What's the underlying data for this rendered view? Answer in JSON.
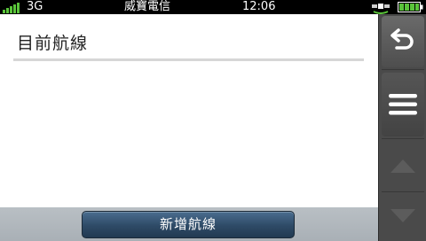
{
  "status_bar": {
    "network": "3G",
    "carrier": "威寶電信",
    "time": "12:06",
    "signal_bars": 5,
    "battery_level": 1.0,
    "accent_color": "#5ac43a"
  },
  "main": {
    "title": "目前航線"
  },
  "bottom_bar": {
    "add_route_label": "新增航線"
  },
  "sidebar": {
    "icons": [
      "back-arrow-icon",
      "menu-icon",
      "arrow-up-icon",
      "arrow-down-icon"
    ]
  }
}
